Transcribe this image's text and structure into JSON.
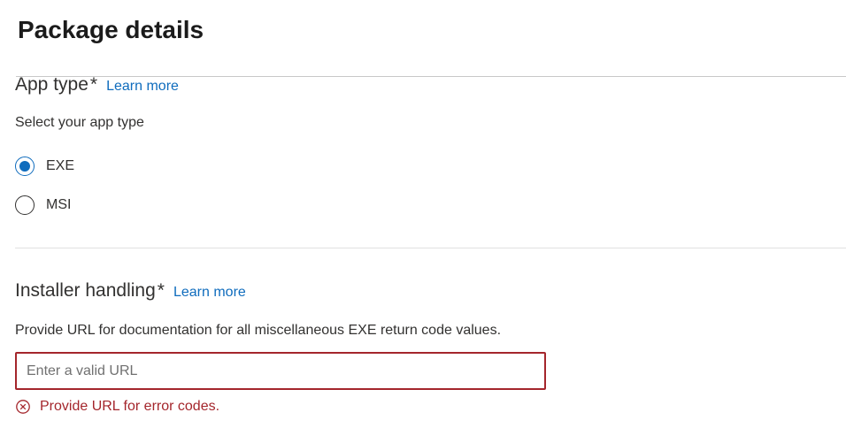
{
  "page": {
    "title": "Package details"
  },
  "app_type": {
    "title": "App type",
    "required_mark": "*",
    "learn_more": "Learn more",
    "description": "Select your app type",
    "options": [
      {
        "label": "EXE",
        "selected": true
      },
      {
        "label": "MSI",
        "selected": false
      }
    ]
  },
  "installer_handling": {
    "title": "Installer handling",
    "required_mark": "*",
    "learn_more": "Learn more",
    "description": "Provide URL for documentation for all miscellaneous EXE return code values.",
    "url_input": {
      "value": "",
      "placeholder": "Enter a valid URL"
    },
    "error": {
      "icon": "error-circle-icon",
      "message": "Provide URL for error codes."
    }
  },
  "colors": {
    "accent": "#0f6cbd",
    "error": "#a4262c",
    "text": "#323130"
  }
}
